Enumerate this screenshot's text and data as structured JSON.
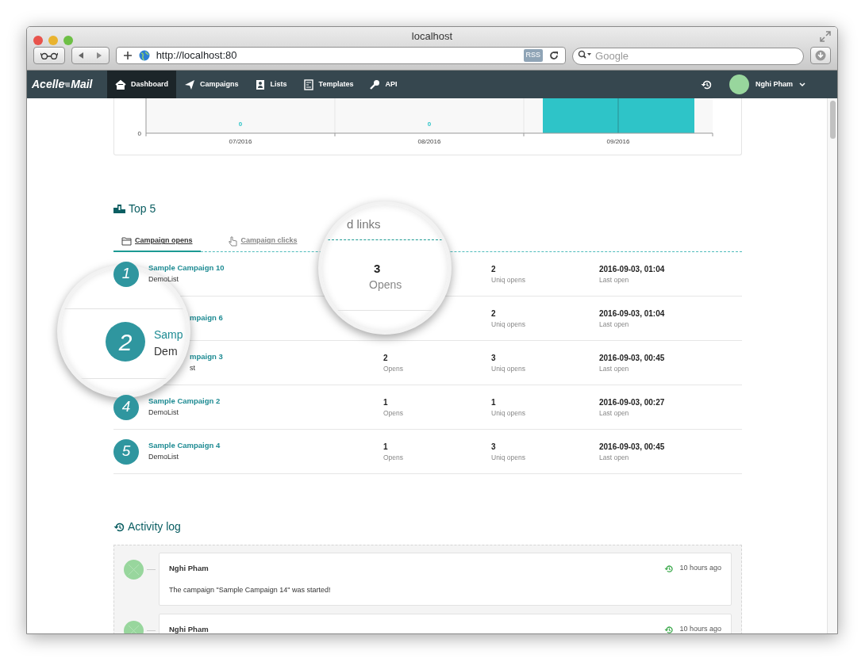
{
  "browser": {
    "title": "localhost",
    "url": "http://localhost:80",
    "rss": "RSS",
    "search": {
      "placeholder": "Google"
    }
  },
  "navbar": {
    "logo": [
      "Acelle",
      "Mail"
    ],
    "items": [
      {
        "label": "Dashboard",
        "selected": true
      },
      {
        "label": "Campaigns",
        "selected": false
      },
      {
        "label": "Lists",
        "selected": false
      },
      {
        "label": "Templates",
        "selected": false
      },
      {
        "label": "API",
        "selected": false
      }
    ],
    "user": "Nghi Pham"
  },
  "chart": {
    "y_tick": "0",
    "categories": [
      {
        "label": "07/2016",
        "value_label": "0",
        "bar": false
      },
      {
        "label": "08/2016",
        "value_label": "0",
        "bar": false
      },
      {
        "label": "09/2016",
        "bar": true
      }
    ]
  },
  "top5": {
    "title": "Top 5",
    "tabs": [
      {
        "label": "Campaign opens",
        "selected": true
      },
      {
        "label": "Campaign clicks",
        "selected": false
      }
    ],
    "rows": [
      {
        "rank": "1",
        "name": "Sample Campaign 10",
        "list": "DemoList",
        "uniq": "2",
        "uniq_label": "Uniq opens",
        "last": "2016-09-03, 01:04",
        "last_label": "Last open"
      },
      {
        "partial": true,
        "name": "mpaign 6",
        "uniq": "2",
        "uniq_label": "Uniq opens",
        "last": "2016-09-03, 01:04",
        "last_label": "Last open"
      },
      {
        "partial": true,
        "name": "mpaign 3",
        "list": "st",
        "opens": "2",
        "opens_label": "Opens",
        "uniq": "3",
        "uniq_label": "Uniq opens",
        "last": "2016-09-03, 00:45",
        "last_label": "Last open"
      },
      {
        "rank": "4",
        "name": "Sample Campaign 2",
        "list": "DemoList",
        "opens": "1",
        "opens_label": "Opens",
        "uniq": "1",
        "uniq_label": "Uniq opens",
        "last": "2016-09-03, 00:27",
        "last_label": "Last open"
      },
      {
        "rank": "5",
        "name": "Sample Campaign 4",
        "list": "DemoList",
        "opens": "1",
        "opens_label": "Opens",
        "uniq": "3",
        "uniq_label": "Uniq opens",
        "last": "2016-09-03, 00:45",
        "last_label": "Last open"
      }
    ]
  },
  "lenses": [
    {
      "kind": "rank",
      "rank": "2",
      "name": "Samp",
      "list": "Dem"
    },
    {
      "kind": "stat",
      "heading": "d links",
      "value": "3",
      "label": "Opens"
    }
  ],
  "activity": {
    "title": "Activity log",
    "entries": [
      {
        "user": "Nghi Pham",
        "time": "10 hours ago",
        "message": {
          "before": "The campaign \"",
          "link": "Sample Campaign 14",
          "after": "\" was started!"
        }
      },
      {
        "user": "Nghi Pham",
        "time": "10 hours ago"
      }
    ]
  }
}
